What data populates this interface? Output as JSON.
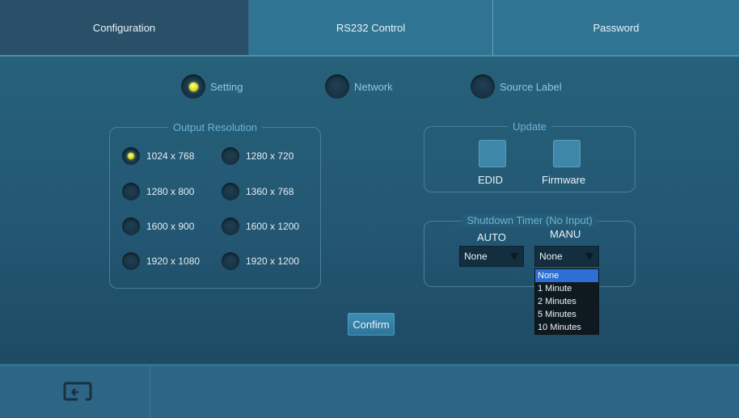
{
  "tabs": [
    {
      "label": "Configuration"
    },
    {
      "label": "RS232 Control"
    },
    {
      "label": "Password"
    }
  ],
  "subtabs": [
    {
      "label": "Setting",
      "selected": true
    },
    {
      "label": "Network",
      "selected": false
    },
    {
      "label": "Source Label",
      "selected": false
    }
  ],
  "output_resolution": {
    "title": "Output Resolution",
    "options": [
      {
        "label": "1024 x 768",
        "selected": true
      },
      {
        "label": "1280 x 720",
        "selected": false
      },
      {
        "label": "1280 x 800",
        "selected": false
      },
      {
        "label": "1360 x 768",
        "selected": false
      },
      {
        "label": "1600 x 900",
        "selected": false
      },
      {
        "label": "1600 x 1200",
        "selected": false
      },
      {
        "label": "1920 x 1080",
        "selected": false
      },
      {
        "label": "1920 x 1200",
        "selected": false
      }
    ]
  },
  "update": {
    "title": "Update",
    "edid_label": "EDID",
    "firmware_label": "Firmware"
  },
  "shutdown": {
    "title": "Shutdown Timer (No Input)",
    "auto_label": "AUTO",
    "manu_label": "MANU",
    "auto_value": "None",
    "manu_value": "None",
    "options": [
      "None",
      "1 Minute",
      "2 Minutes",
      "5 Minutes",
      "10 Minutes"
    ],
    "highlighted_option": "None"
  },
  "confirm_label": "Confirm",
  "colors": {
    "accent": "#2f7593",
    "radio_selected": "#d8dd1f",
    "dropdown_highlight": "#2d6fd2"
  },
  "icons": {
    "back": "return-icon"
  }
}
